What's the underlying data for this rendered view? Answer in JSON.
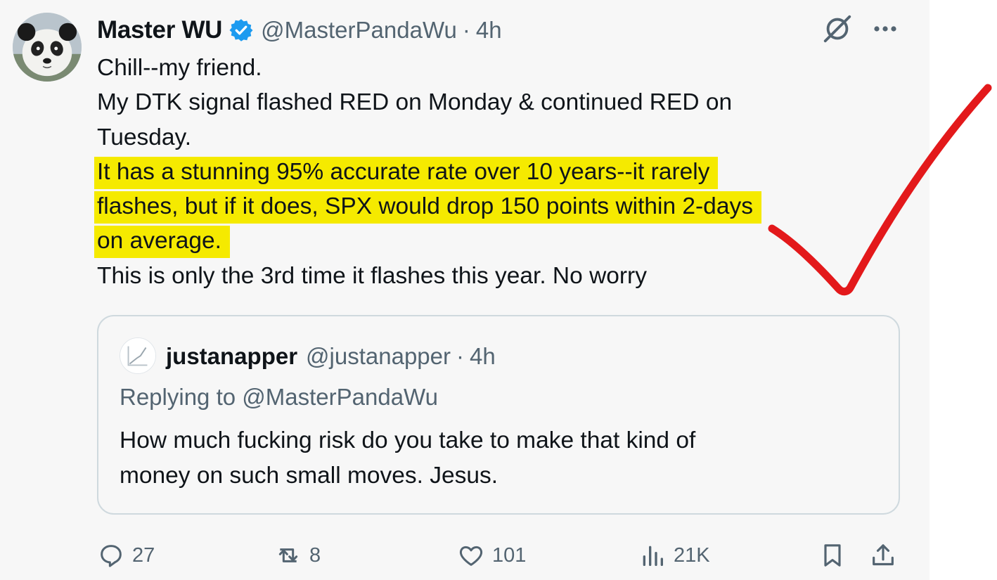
{
  "tweet": {
    "display_name": "Master WU",
    "handle": "@MasterPandaWu",
    "separator": "·",
    "time": "4h",
    "verified_icon": "verified-badge-icon",
    "lines": [
      "Chill--my friend.",
      "My DTK signal flashed RED on Monday & continued RED on",
      "Tuesday."
    ],
    "highlighted_lines": [
      "It has a stunning 95% accurate rate over 10 years--it rarely",
      "flashes, but if it does, SPX would drop 150 points within 2-days",
      "on average."
    ],
    "last_line": "This is only the 3rd time it flashes this year. No worry",
    "highlight_color": "#f5ea00",
    "annotation_color": "#e3191b"
  },
  "quote": {
    "display_name": "justanapper",
    "handle": "@justanapper",
    "separator": "·",
    "time": "4h",
    "replying_to": "Replying to @MasterPandaWu",
    "lines": [
      "How much fucking risk do you take to make that kind of",
      "money on such small moves. Jesus."
    ]
  },
  "actions": {
    "replies": "27",
    "reposts": "8",
    "likes": "101",
    "views": "21K"
  },
  "icons": [
    "grok-icon",
    "more-icon",
    "reply-icon",
    "repost-icon",
    "like-icon",
    "views-icon",
    "bookmark-icon",
    "share-icon"
  ],
  "colors": {
    "secondary_text": "#536471",
    "verified_blue": "#1d9bf0",
    "border": "#cfd9de"
  }
}
